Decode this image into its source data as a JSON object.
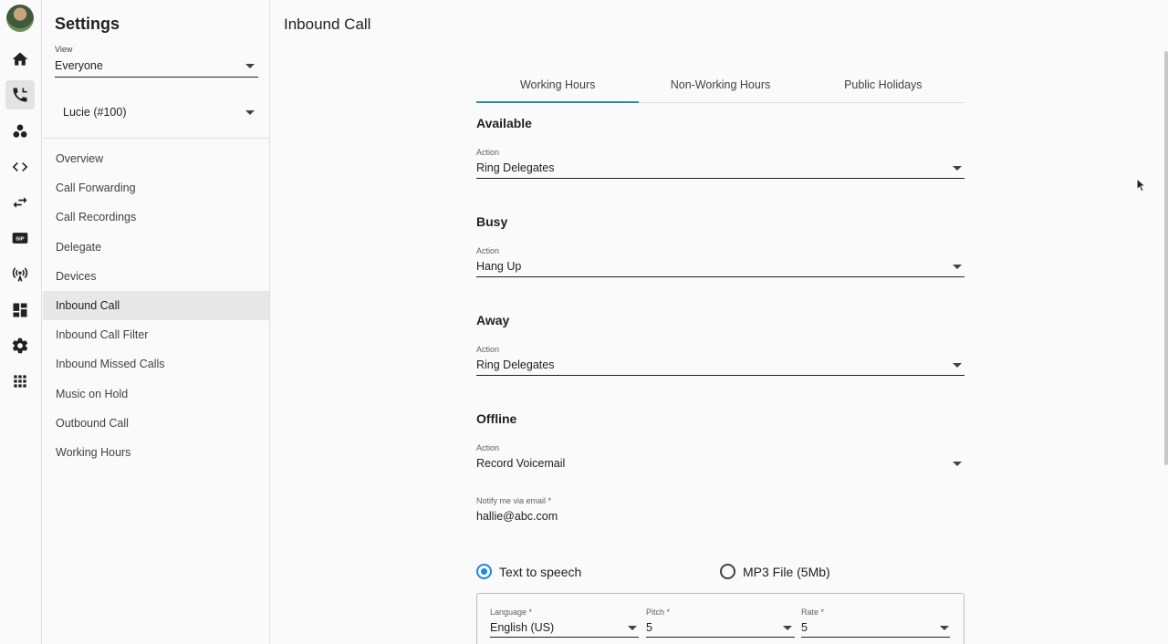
{
  "rail": {
    "icons": [
      "home-icon",
      "phone-icon",
      "contacts-icon",
      "code-icon",
      "swap-icon",
      "sip-icon",
      "antenna-icon",
      "dashboard-icon",
      "gear-icon",
      "apps-icon"
    ]
  },
  "settings": {
    "title": "Settings",
    "view_label": "View",
    "view_value": "Everyone",
    "user_value": "Lucie (#100)",
    "nav": [
      "Overview",
      "Call Forwarding",
      "Call Recordings",
      "Delegate",
      "Devices",
      "Inbound Call",
      "Inbound Call Filter",
      "Inbound Missed Calls",
      "Music on Hold",
      "Outbound Call",
      "Working Hours"
    ],
    "active_nav": "Inbound Call"
  },
  "main": {
    "title": "Inbound Call",
    "tabs": [
      "Working Hours",
      "Non-Working Hours",
      "Public Holidays"
    ],
    "active_tab": "Working Hours",
    "sections": [
      {
        "title": "Available",
        "action_label": "Action",
        "action_value": "Ring Delegates"
      },
      {
        "title": "Busy",
        "action_label": "Action",
        "action_value": "Hang Up"
      },
      {
        "title": "Away",
        "action_label": "Action",
        "action_value": "Ring Delegates"
      },
      {
        "title": "Offline",
        "action_label": "Action",
        "action_value": "Record Voicemail"
      }
    ],
    "email_label": "Notify me via email *",
    "email_value": "hallie@abc.com",
    "radio_tts": "Text to speech",
    "radio_mp3": "MP3 File (5Mb)",
    "radio_selected": "Text to speech",
    "tts": {
      "language_label": "Language *",
      "language_value": "English (US)",
      "pitch_label": "Pitch *",
      "pitch_value": "5",
      "rate_label": "Rate *",
      "rate_value": "5"
    }
  },
  "colors": {
    "accent": "#1e88e5",
    "tab_indicator": "#2a8ab5"
  }
}
